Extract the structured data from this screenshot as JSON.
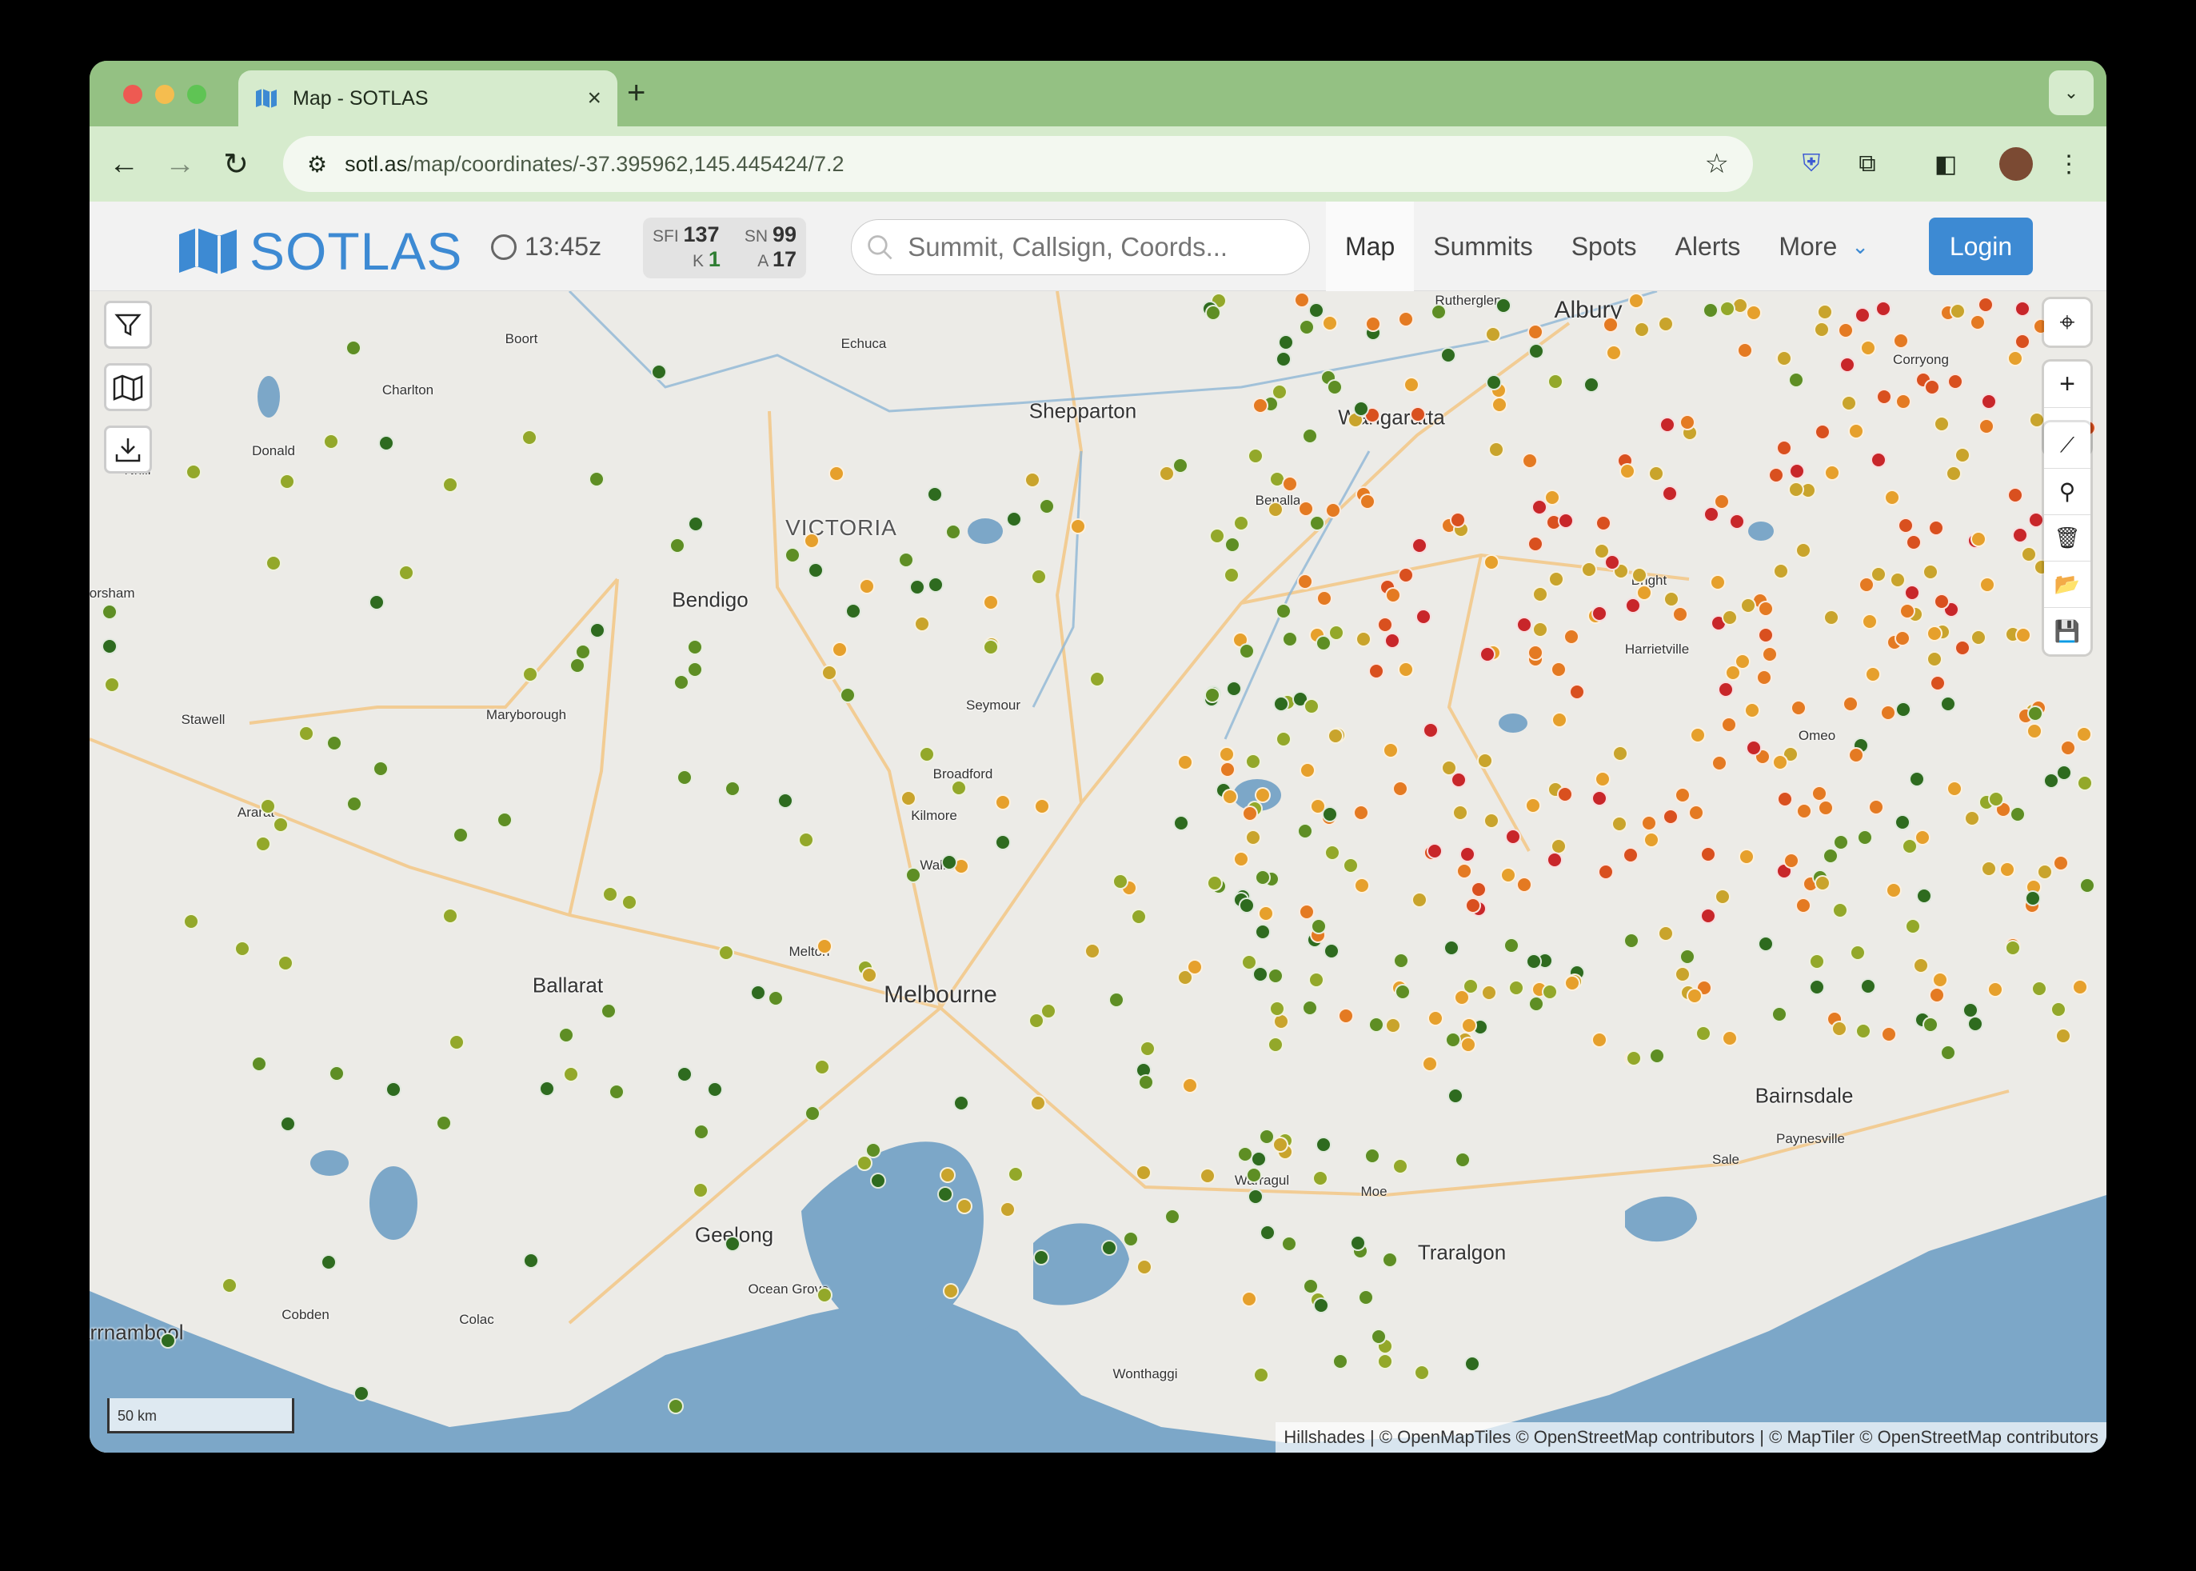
{
  "browser": {
    "tab_title": "Map - SOTLAS",
    "new_tab": "+",
    "url_host": "sotl.as",
    "url_path": "/map/coordinates/-37.395962,145.445424/7.2"
  },
  "header": {
    "logo_text": "SOTLAS",
    "time": "13:45z",
    "solar": {
      "sfi_label": "SFI",
      "sfi": "137",
      "sn_label": "SN",
      "sn": "99",
      "k_label": "K",
      "k": "1",
      "a_label": "A",
      "a": "17"
    },
    "search_placeholder": "Summit, Callsign, Coords...",
    "nav": [
      "Map",
      "Summits",
      "Spots",
      "Alerts",
      "More"
    ],
    "login": "Login",
    "accent": "#3d8ad3"
  },
  "map": {
    "places": [
      {
        "name": "Albury",
        "size": "big"
      },
      {
        "name": "Shepparton",
        "size": "mid"
      },
      {
        "name": "Wangaratta",
        "size": "mid"
      },
      {
        "name": "VICTORIA",
        "size": "region"
      },
      {
        "name": "Bendigo",
        "size": "mid"
      },
      {
        "name": "Ballarat",
        "size": "mid"
      },
      {
        "name": "Melbourne",
        "size": "big"
      },
      {
        "name": "Geelong",
        "size": "mid"
      },
      {
        "name": "Traralgon",
        "size": "mid"
      },
      {
        "name": "Bairnsdale",
        "size": "mid"
      },
      {
        "name": "Warrnambool",
        "size": "mid"
      },
      {
        "name": "Rutherglen",
        "size": "small"
      },
      {
        "name": "Boort",
        "size": "small"
      },
      {
        "name": "Echuca",
        "size": "small"
      },
      {
        "name": "Charlton",
        "size": "small"
      },
      {
        "name": "Donald",
        "size": "small"
      },
      {
        "name": "Corryong",
        "size": "small"
      },
      {
        "name": "Benalla",
        "size": "small"
      },
      {
        "name": "Bright",
        "size": "small"
      },
      {
        "name": "Harrietville",
        "size": "small"
      },
      {
        "name": "Omeo",
        "size": "small"
      },
      {
        "name": "Stawell",
        "size": "small"
      },
      {
        "name": "Maryborough",
        "size": "small"
      },
      {
        "name": "Ararat",
        "size": "small"
      },
      {
        "name": "Seymour",
        "size": "small"
      },
      {
        "name": "Broadford",
        "size": "small"
      },
      {
        "name": "Kilmore",
        "size": "small"
      },
      {
        "name": "Wallan",
        "size": "small"
      },
      {
        "name": "Melton",
        "size": "small"
      },
      {
        "name": "Warragul",
        "size": "small"
      },
      {
        "name": "Moe",
        "size": "small"
      },
      {
        "name": "Sale",
        "size": "small"
      },
      {
        "name": "Paynesville",
        "size": "small"
      },
      {
        "name": "Ocean Grove",
        "size": "small"
      },
      {
        "name": "Cobden",
        "size": "small"
      },
      {
        "name": "Colac",
        "size": "small"
      },
      {
        "name": "Wonthaggi",
        "size": "small"
      },
      {
        "name": "Horsham",
        "size": "small"
      },
      {
        "name": "Nhill",
        "size": "small"
      }
    ],
    "summit_colors": [
      "#2e6b1f",
      "#5e8e24",
      "#93a82a",
      "#c9a42c",
      "#e6a02c",
      "#e47a22",
      "#d9501f",
      "#c8262a"
    ],
    "scale": "50 km",
    "attribution": "Hillshades | © OpenMapTiles © OpenStreetMap contributors | © MapTiler © OpenStreetMap contributors"
  }
}
